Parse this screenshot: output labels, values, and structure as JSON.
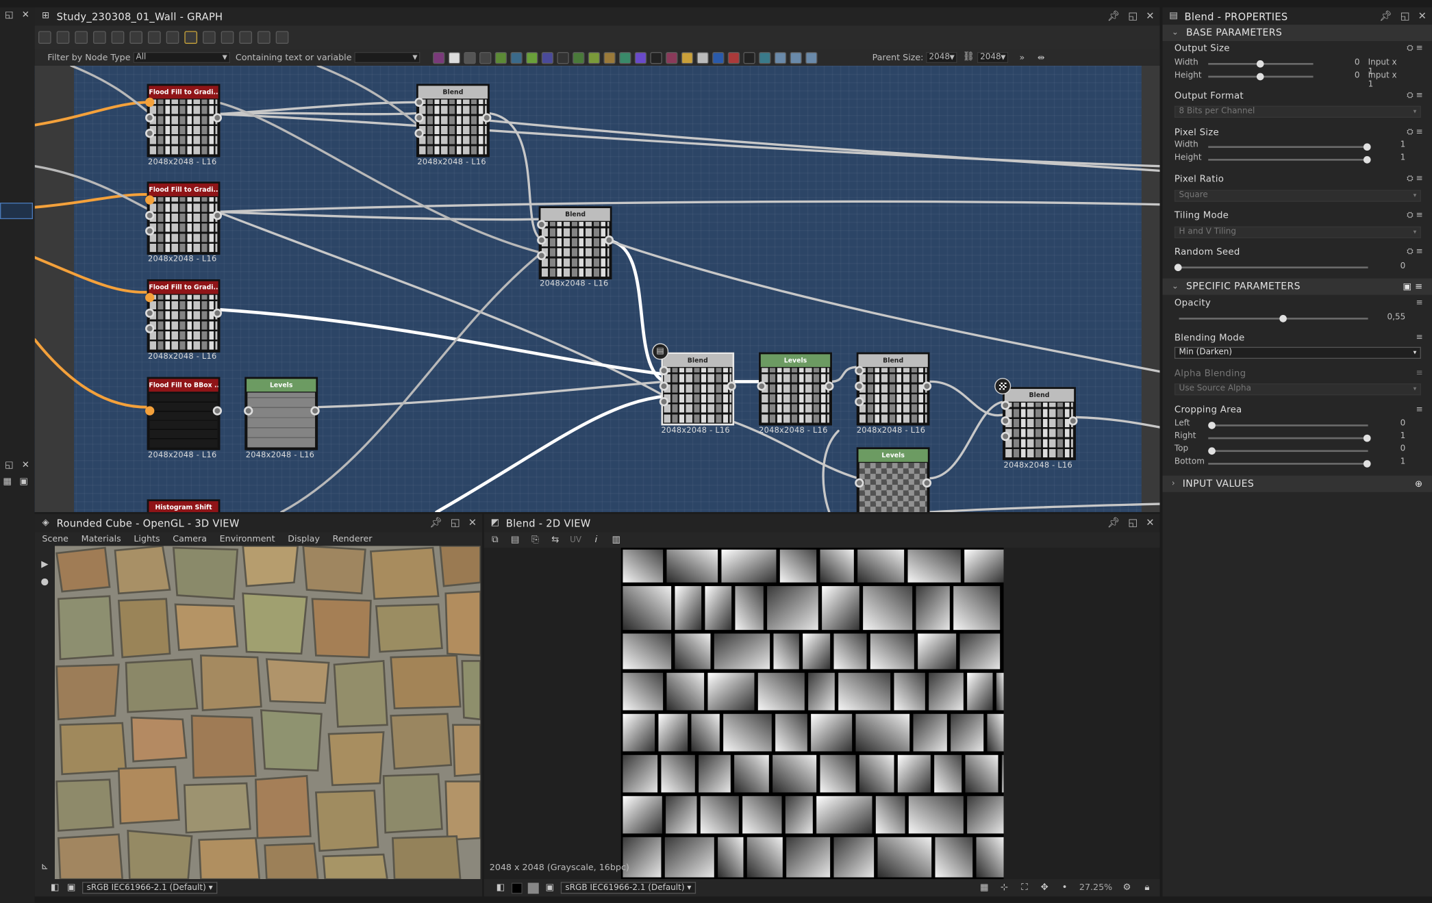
{
  "graph": {
    "title": "Study_230308_01_Wall - GRAPH",
    "filter_label": "Filter by Node Type",
    "filter_value": "All",
    "containing_label": "Containing text or variable",
    "parent_size_label": "Parent Size:",
    "parent_size_a": "2048",
    "parent_size_b": "2048",
    "nodes": [
      {
        "title": "Flood Fill to Gradi...",
        "size": "2048x2048 - L16"
      },
      {
        "title": "Blend",
        "size": "2048x2048 - L16"
      },
      {
        "title": "Flood Fill to Gradi...",
        "size": "2048x2048 - L16"
      },
      {
        "title": "Blend",
        "size": "2048x2048 - L16"
      },
      {
        "title": "Flood Fill to Gradi...",
        "size": "2048x2048 - L16"
      },
      {
        "title": "Flood Fill to BBox ...",
        "size": "2048x2048 - L16"
      },
      {
        "title": "Levels",
        "size": "2048x2048 - L16"
      },
      {
        "title": "Blend",
        "size": "2048x2048 - L16"
      },
      {
        "title": "Levels",
        "size": "2048x2048 - L16"
      },
      {
        "title": "Blend",
        "size": "2048x2048 - L16"
      },
      {
        "title": "Blend",
        "size": "2048x2048 - L16"
      },
      {
        "title": "Levels",
        "size": ""
      },
      {
        "title": "Histogram Shift",
        "size": ""
      }
    ]
  },
  "view3d": {
    "title": "Rounded Cube - OpenGL - 3D VIEW",
    "menu": [
      "Scene",
      "Materials",
      "Lights",
      "Camera",
      "Environment",
      "Display",
      "Renderer"
    ],
    "colorspace": "sRGB IEC61966-2.1 (Default)"
  },
  "view2d": {
    "title": "Blend - 2D VIEW",
    "uv_label": "UV",
    "info": "2048 x 2048 (Grayscale, 16bpc)",
    "colorspace": "sRGB IEC61966-2.1 (Default)",
    "zoom": "27.25%"
  },
  "props": {
    "title": "Blend - PROPERTIES",
    "base_section": "BASE PARAMETERS",
    "output_size": {
      "label": "Output Size",
      "width_label": "Width",
      "height_label": "Height",
      "width_val": "0",
      "height_val": "0",
      "width_mode": "Input x 1",
      "height_mode": "Input x 1"
    },
    "output_format": {
      "label": "Output Format",
      "value": "8 Bits per Channel"
    },
    "pixel_size": {
      "label": "Pixel Size",
      "width_label": "Width",
      "height_label": "Height",
      "width_val": "1",
      "height_val": "1"
    },
    "pixel_ratio": {
      "label": "Pixel Ratio",
      "value": "Square"
    },
    "tiling_mode": {
      "label": "Tiling Mode",
      "value": "H and V Tiling"
    },
    "random_seed": {
      "label": "Random Seed",
      "value": "0"
    },
    "specific_section": "SPECIFIC PARAMETERS",
    "opacity": {
      "label": "Opacity",
      "value": "0,55",
      "fraction": 0.55
    },
    "blending_mode": {
      "label": "Blending Mode",
      "value": "Min (Darken)"
    },
    "alpha_blending": {
      "label": "Alpha Blending",
      "value": "Use Source Alpha"
    },
    "cropping": {
      "label": "Cropping Area",
      "left_label": "Left",
      "right_label": "Right",
      "top_label": "Top",
      "bottom_label": "Bottom",
      "left_val": "0",
      "right_val": "1",
      "top_val": "0",
      "bottom_val": "1"
    },
    "input_section": "INPUT VALUES"
  }
}
